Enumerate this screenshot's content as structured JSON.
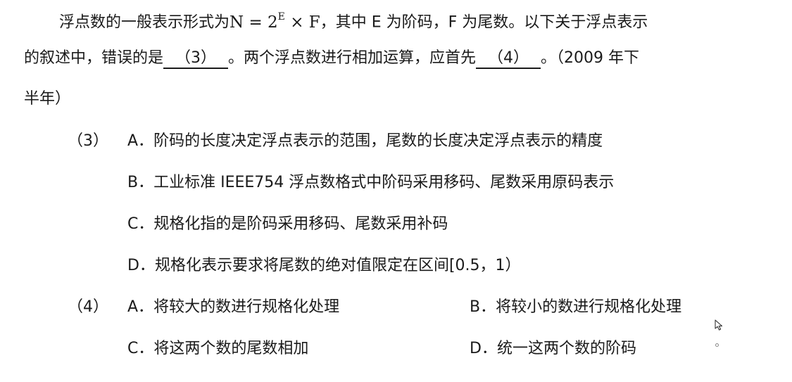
{
  "question": {
    "line1_pre": "浮点数的一般表示形式为",
    "formula_base": "N = 2",
    "formula_exp": "E",
    "formula_tail": " × F",
    "line1_post": "，其中 E 为阶码，F 为尾数。以下关于浮点表示",
    "line2_pre": "的叙述中，错误的是",
    "blank3": "（3）",
    "line2_mid": "。两个浮点数进行相加运算，应首先",
    "blank4": "（4）",
    "line2_post": "。（2009 年下",
    "line3": "半年）"
  },
  "q3": {
    "number": "（3）",
    "options": [
      {
        "letter": "A．",
        "text": "阶码的长度决定浮点表示的范围，尾数的长度决定浮点表示的精度"
      },
      {
        "letter": "B．",
        "text": "工业标准 IEEE754 浮点数格式中阶码采用移码、尾数采用原码表示"
      },
      {
        "letter": "C．",
        "text": "规格化指的是阶码采用移码、尾数采用补码"
      },
      {
        "letter": "D．",
        "text": "规格化表示要求将尾数的绝对值限定在区间[0.5，1）"
      }
    ]
  },
  "q4": {
    "number": "（4）",
    "options": [
      {
        "letter": "A．",
        "text": "将较大的数进行规格化处理"
      },
      {
        "letter": "B．",
        "text": "将较小的数进行规格化处理"
      },
      {
        "letter": "C．",
        "text": "将这两个数的尾数相加"
      },
      {
        "letter": "D．",
        "text": "统一这两个数的阶码"
      }
    ]
  },
  "icons": {
    "cursor": "mouse-pointer-icon"
  }
}
